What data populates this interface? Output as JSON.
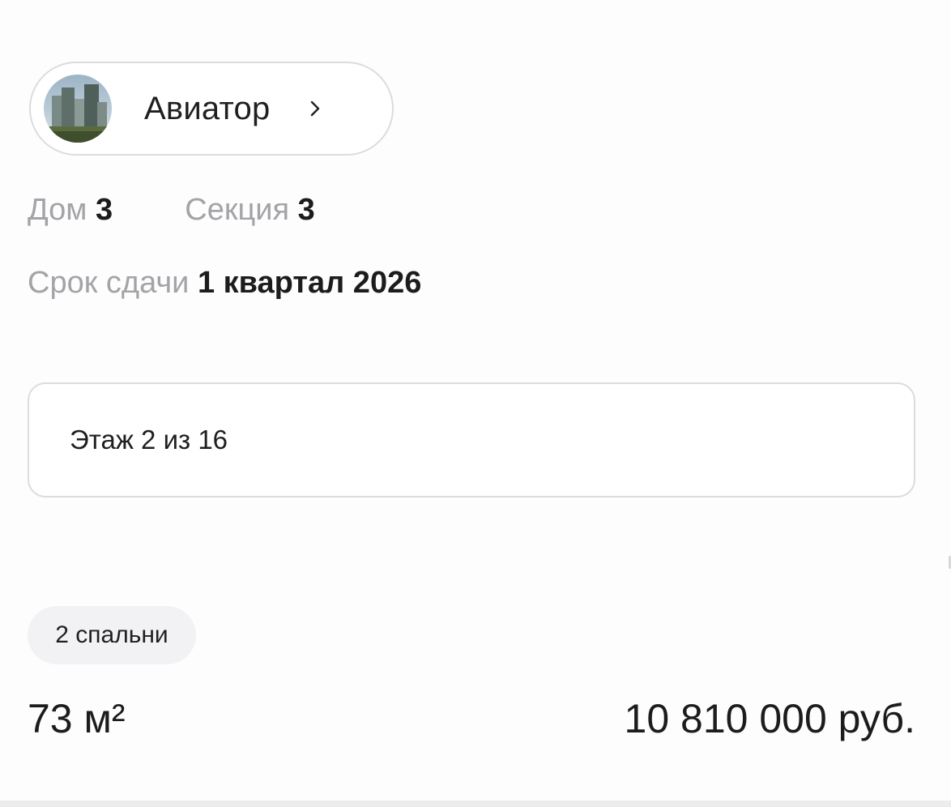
{
  "complex": {
    "name": "Авиатор",
    "avatar_icon": "building-photo-icon",
    "chevron_icon": "chevron-right-icon"
  },
  "house": {
    "label": "Дом",
    "value": "3"
  },
  "section": {
    "label": "Секция",
    "value": "3"
  },
  "deadline": {
    "label": "Срок сдачи",
    "value": "1 квартал 2026"
  },
  "floor": {
    "text": "Этаж 2 из 16"
  },
  "bedrooms": {
    "text": "2 спальни"
  },
  "area": {
    "value": "73 м²"
  },
  "price": {
    "value": "10 810 000 руб."
  },
  "colors": {
    "text_primary": "#1c1c1e",
    "text_secondary": "#a3a3a8",
    "border": "#dcdcdf",
    "chip_bg": "#f2f2f4",
    "background": "#fdfdfd"
  }
}
